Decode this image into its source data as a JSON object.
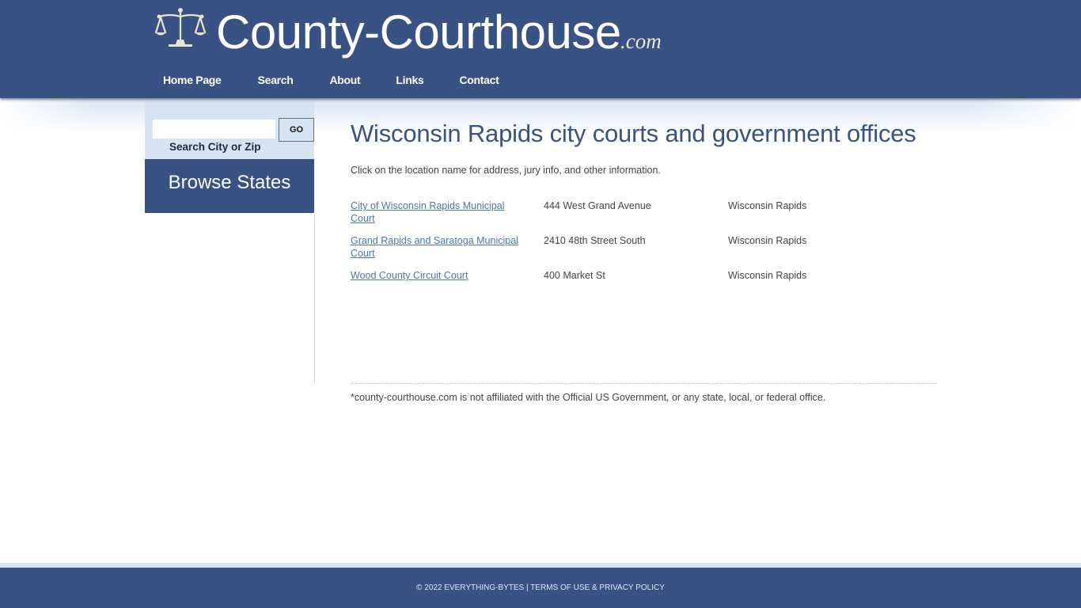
{
  "header": {
    "logo_icon": "scales-of-justice-icon",
    "site_name": "County-Courthouse",
    "site_tld": ".com",
    "nav": [
      {
        "label": "Home Page"
      },
      {
        "label": "Search"
      },
      {
        "label": "About"
      },
      {
        "label": "Links"
      },
      {
        "label": "Contact"
      }
    ]
  },
  "sidebar": {
    "search": {
      "value": "",
      "placeholder": "",
      "button_label": "GO",
      "caption": "Search City or Zip"
    },
    "browse_states_label": "Browse States"
  },
  "main": {
    "title": "Wisconsin Rapids city courts and government offices",
    "intro": "Click on the location name for address, jury info, and other information.",
    "locations": [
      {
        "name": "City of Wisconsin Rapids Municipal Court",
        "address": "444 West Grand Avenue",
        "city": "Wisconsin Rapids"
      },
      {
        "name": "Grand Rapids and Saratoga Municipal Court",
        "address": "2410 48th Street South",
        "city": "Wisconsin Rapids"
      },
      {
        "name": "Wood County Circuit Court",
        "address": "400 Market St",
        "city": "Wisconsin Rapids"
      }
    ],
    "disclaimer": "*county-courthouse.com is not affiliated with the Official US Government, or any state, local, or federal office."
  },
  "footer": {
    "text": "© 2022 EVERYTHING-BYTES | TERMS OF USE & PRIVACY POLICY"
  },
  "colors": {
    "brand_blue": "#385283",
    "light_blue": "#d5e3f2",
    "link": "#4a76b0",
    "body_text": "#444444"
  }
}
